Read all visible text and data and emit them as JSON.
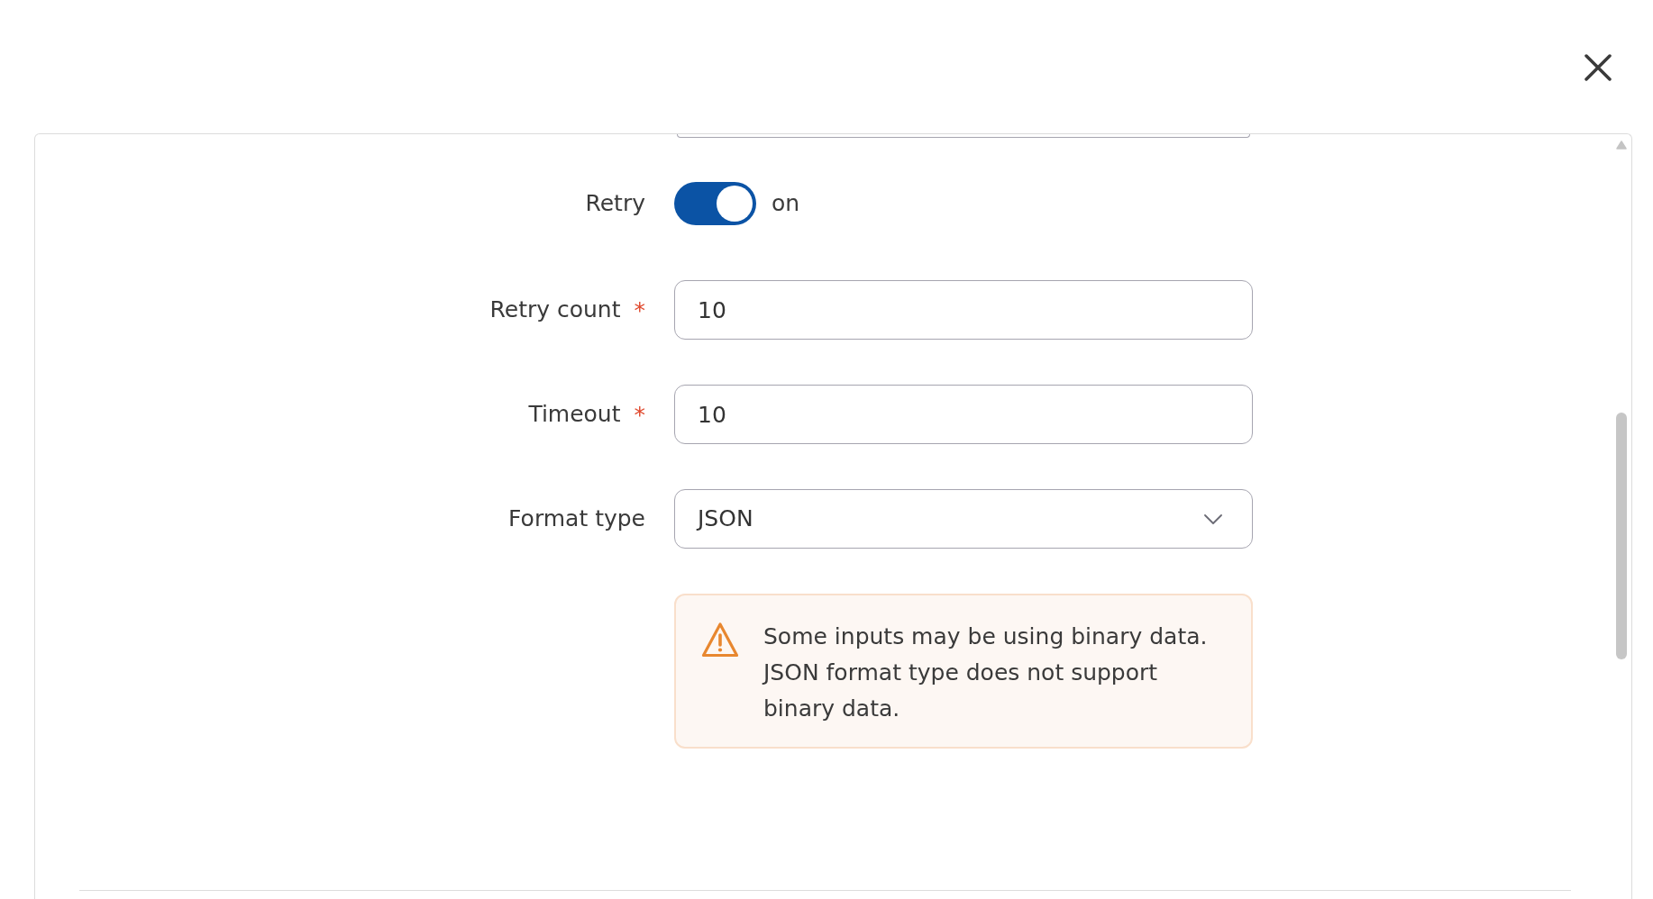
{
  "form": {
    "fields": [
      {
        "kind": "cut_off_input"
      },
      {
        "kind": "toggle",
        "label": "Retry",
        "on": true,
        "state_label": "on"
      },
      {
        "kind": "input",
        "label": "Retry count",
        "required_mark": "*",
        "value": "10"
      },
      {
        "kind": "input",
        "label": "Timeout",
        "required_mark": "*",
        "value": "10"
      },
      {
        "kind": "select",
        "label": "Format type",
        "value": "JSON"
      }
    ],
    "alert": {
      "kind": "warning",
      "text": "Some inputs may be using binary data. JSON format type does not support binary data."
    }
  }
}
